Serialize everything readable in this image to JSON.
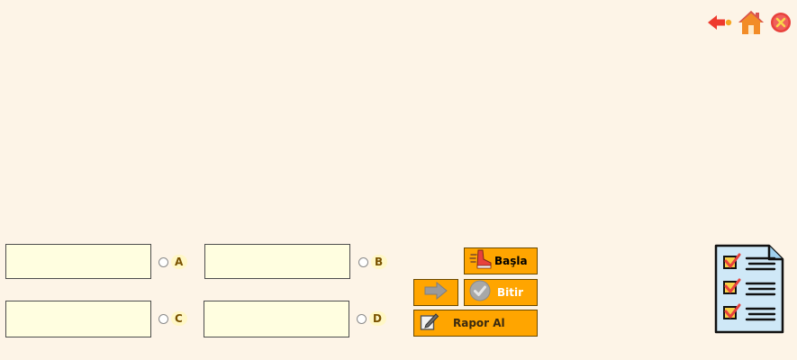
{
  "options": [
    {
      "letter": "A"
    },
    {
      "letter": "B"
    },
    {
      "letter": "C"
    },
    {
      "letter": "D"
    }
  ],
  "buttons": {
    "start_label": "Başla",
    "finish_label": "Bitir",
    "report_label": "Rapor Al"
  },
  "icons": {
    "top": [
      "back-arrow-icon",
      "home-icon",
      "close-icon"
    ],
    "next": "arrow-right-icon",
    "start": "running-shoe-icon",
    "finish": "check-circle-icon",
    "report": "pencil-note-icon",
    "decor": "checklist-icon"
  },
  "colors": {
    "background": "#fdf4e7",
    "answer_box": "#fffee0",
    "button": "#ffa500",
    "close": "#e8413c",
    "home": "#f28c28"
  }
}
